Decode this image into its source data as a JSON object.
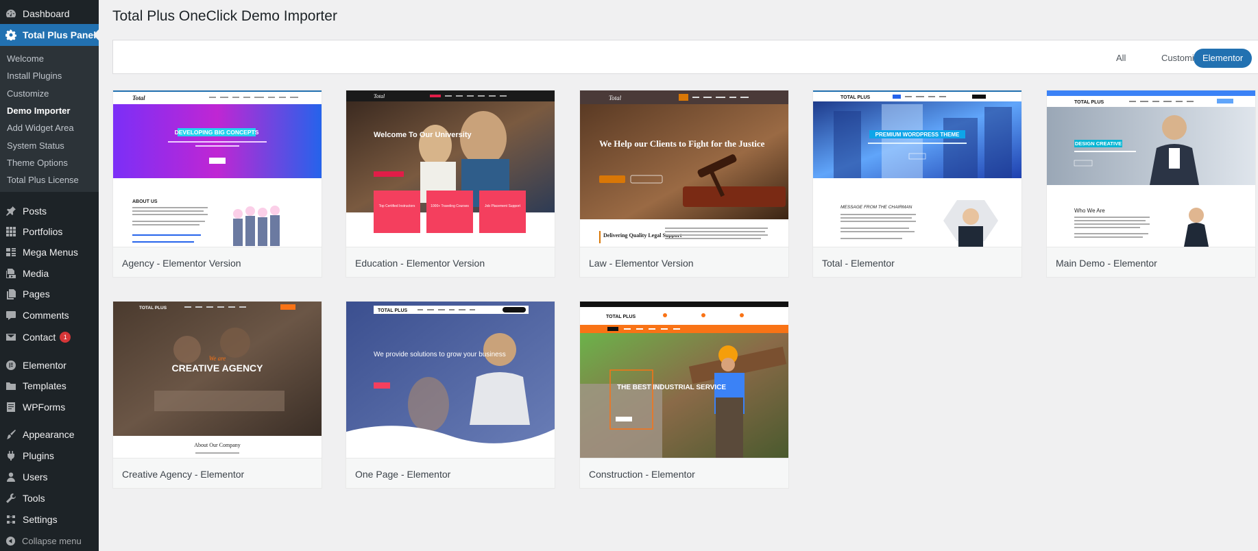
{
  "sidebar": {
    "top_items": [
      {
        "label": "Dashboard",
        "icon": "dashboard-icon"
      },
      {
        "label": "Total Plus Panel",
        "icon": "gear-icon"
      }
    ],
    "submenu": [
      {
        "label": "Welcome"
      },
      {
        "label": "Install Plugins"
      },
      {
        "label": "Customize"
      },
      {
        "label": "Demo Importer"
      },
      {
        "label": "Add Widget Area"
      },
      {
        "label": "System Status"
      },
      {
        "label": "Theme Options"
      },
      {
        "label": "Total Plus License"
      }
    ],
    "items": [
      {
        "label": "Posts",
        "icon": "pin-icon"
      },
      {
        "label": "Portfolios",
        "icon": "grid-icon"
      },
      {
        "label": "Mega Menus",
        "icon": "menu-grid-icon"
      },
      {
        "label": "Media",
        "icon": "media-icon"
      },
      {
        "label": "Pages",
        "icon": "pages-icon"
      },
      {
        "label": "Comments",
        "icon": "comment-icon"
      },
      {
        "label": "Contact",
        "icon": "mail-icon",
        "badge": "1"
      },
      {
        "label": "Elementor",
        "icon": "elementor-icon"
      },
      {
        "label": "Templates",
        "icon": "folder-icon"
      },
      {
        "label": "WPForms",
        "icon": "forms-icon"
      },
      {
        "label": "Appearance",
        "icon": "brush-icon"
      },
      {
        "label": "Plugins",
        "icon": "plug-icon"
      },
      {
        "label": "Users",
        "icon": "user-icon"
      },
      {
        "label": "Tools",
        "icon": "wrench-icon"
      },
      {
        "label": "Settings",
        "icon": "settings-icon"
      }
    ],
    "collapse_label": "Collapse menu"
  },
  "header": {
    "title": "Total Plus OneClick Demo Importer"
  },
  "filters": [
    {
      "label": "All"
    },
    {
      "label": "Customizer"
    },
    {
      "label": "Elementor",
      "active": true
    }
  ],
  "demos": [
    {
      "title": "Agency - Elementor Version",
      "preview": {
        "brand": "Total",
        "hero": "DEVELOPING BIG CONCEPTS",
        "section": "ABOUT US"
      }
    },
    {
      "title": "Education - Elementor Version",
      "preview": {
        "brand": "Total",
        "hero": "Welcome To Our University",
        "features": [
          "Top Certified Instructors",
          "1000+ Traveling Courses",
          "Job Placement Support"
        ]
      }
    },
    {
      "title": "Law - Elementor Version",
      "preview": {
        "brand": "Total",
        "hero": "We Help our Clients to Fight for the Justice",
        "section": "Delivering Quality Legal Support"
      }
    },
    {
      "title": "Total - Elementor",
      "preview": {
        "brand": "TOTAL PLUS",
        "hero": "PREMIUM WORDPRESS THEME",
        "section": "MESSAGE FROM THE CHAIRMAN"
      }
    },
    {
      "title": "Main Demo - Elementor",
      "preview": {
        "brand": "TOTAL PLUS",
        "hero": "DESIGN CREATIVE",
        "section": "Who We Are"
      }
    },
    {
      "title": "Creative Agency - Elementor",
      "preview": {
        "brand": "TOTAL PLUS",
        "hero_small": "We are",
        "hero": "CREATIVE AGENCY",
        "section": "About Our Company"
      }
    },
    {
      "title": "One Page - Elementor",
      "preview": {
        "brand": "TOTAL PLUS",
        "hero": "We provide solutions to grow your business"
      }
    },
    {
      "title": "Construction - Elementor",
      "preview": {
        "brand": "TOTAL PLUS",
        "hero": "THE BEST INDUSTRIAL SERVICE"
      }
    }
  ],
  "colors": {
    "sidebar_bg": "#1d2327",
    "accent": "#2271b1",
    "badge": "#d63638",
    "page_bg": "#f0f0f1"
  }
}
